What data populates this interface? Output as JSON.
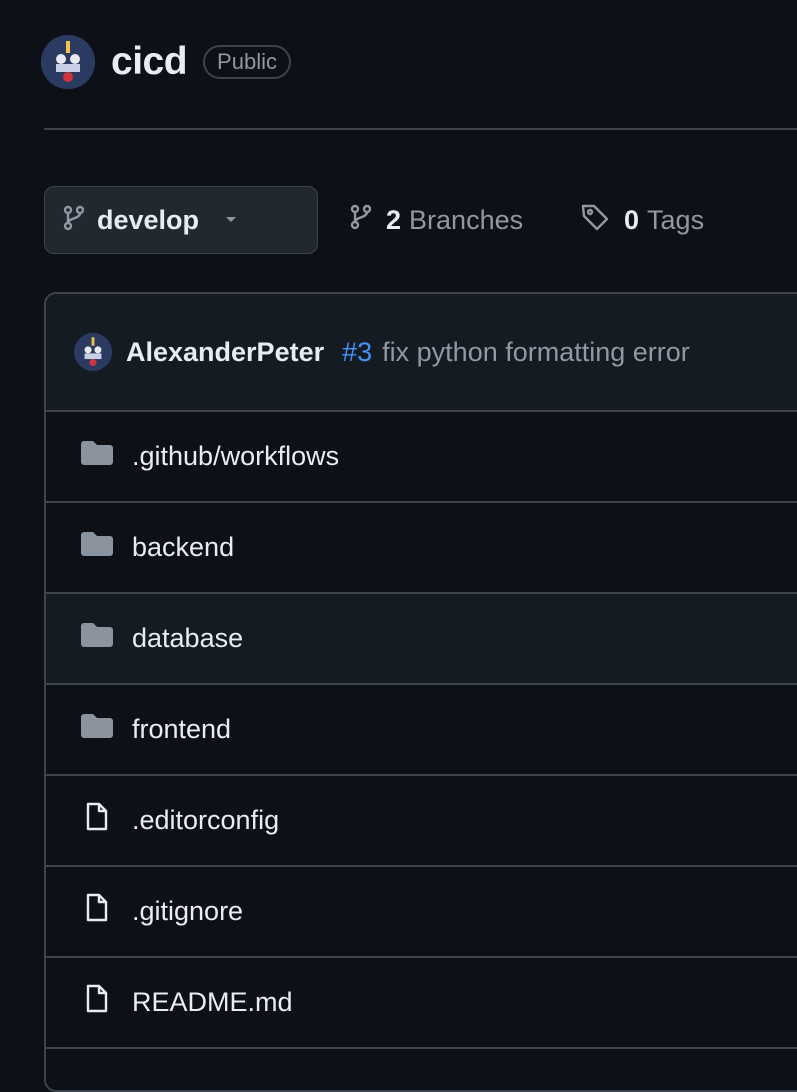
{
  "repo": {
    "name": "cicd",
    "visibility": "Public"
  },
  "branch": {
    "current": "develop"
  },
  "counts": {
    "branches_num": "2",
    "branches_label": "Branches",
    "tags_num": "0",
    "tags_label": "Tags"
  },
  "commit": {
    "author": "AlexanderPeter",
    "pr": "#3",
    "message": "fix python formatting error"
  },
  "files": [
    {
      "name": ".github/workflows",
      "type": "folder"
    },
    {
      "name": "backend",
      "type": "folder"
    },
    {
      "name": "database",
      "type": "folder"
    },
    {
      "name": "frontend",
      "type": "folder"
    },
    {
      "name": ".editorconfig",
      "type": "file"
    },
    {
      "name": ".gitignore",
      "type": "file"
    },
    {
      "name": "README.md",
      "type": "file"
    }
  ],
  "colors": {
    "background": "#0d1117",
    "border": "#3d444d",
    "link": "#4493f8",
    "muted": "#9198a1",
    "folder": "#8b949e"
  }
}
